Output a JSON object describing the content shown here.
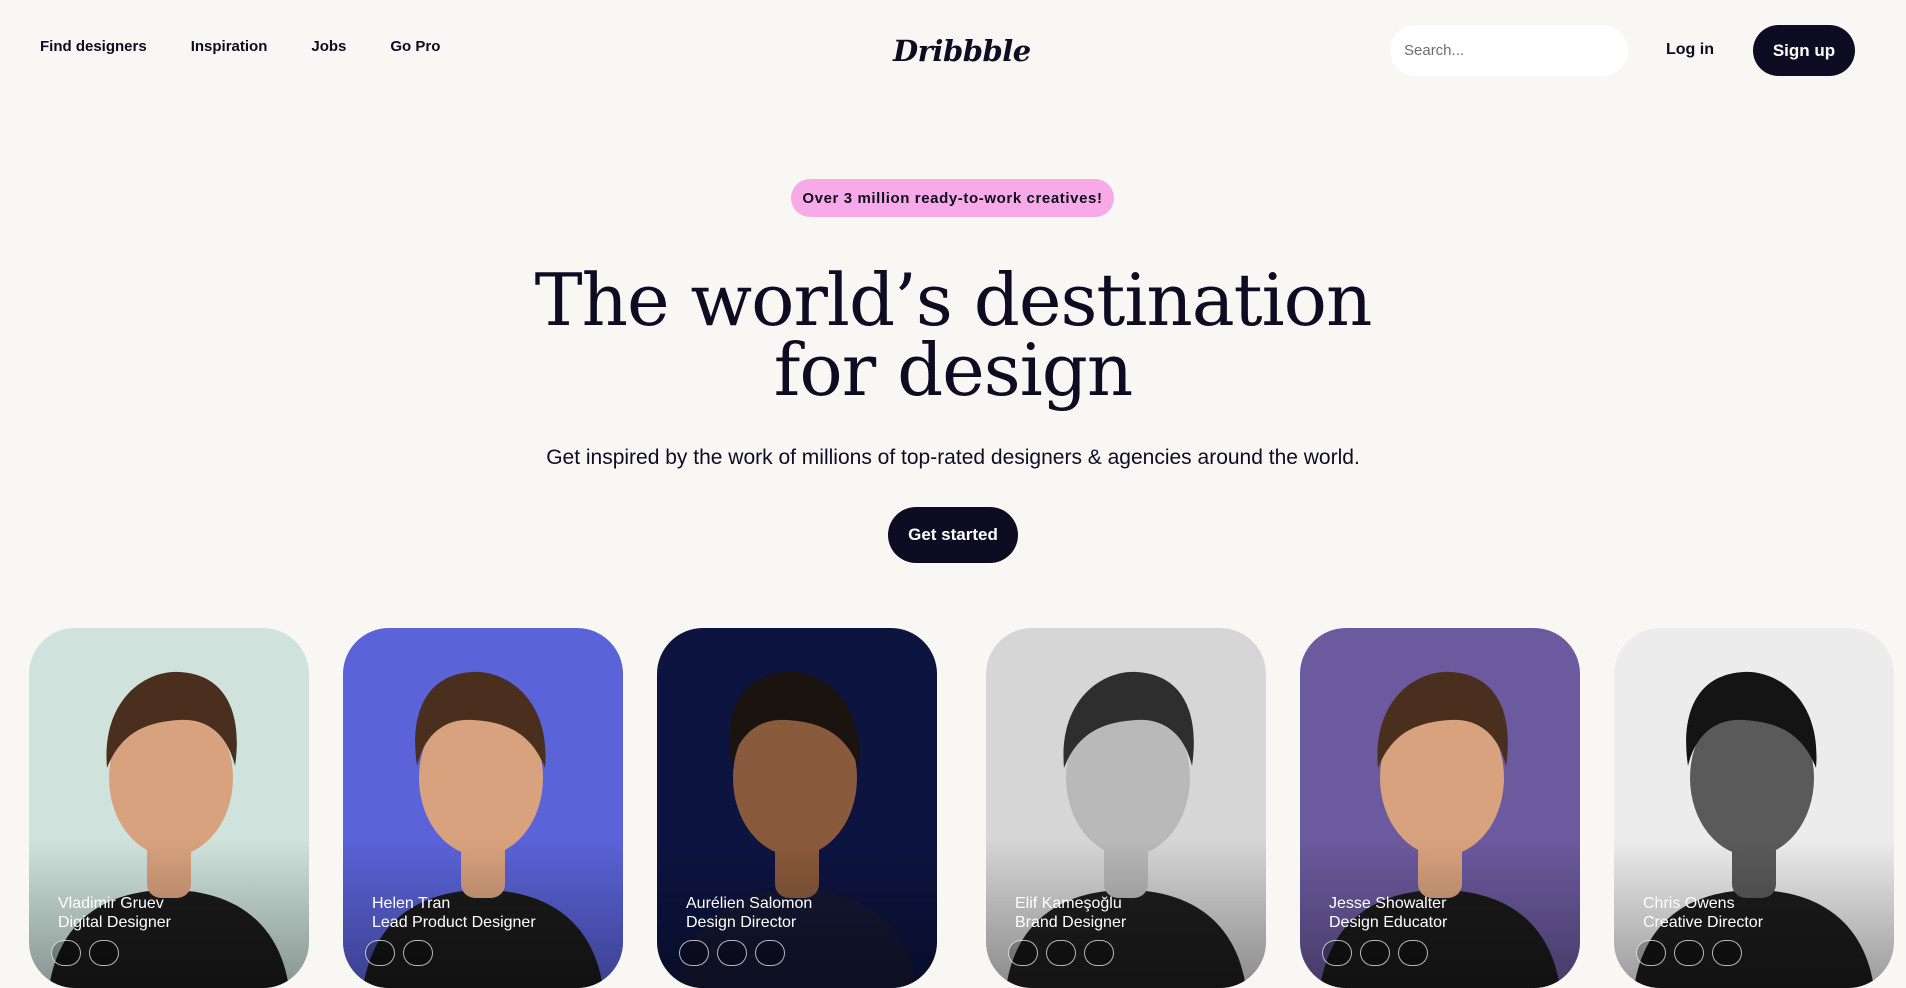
{
  "nav": {
    "links": [
      {
        "label": "Find designers"
      },
      {
        "label": "Inspiration"
      },
      {
        "label": "Jobs"
      },
      {
        "label": "Go Pro"
      }
    ],
    "logo": "Dribbble",
    "search_placeholder": "Search...",
    "login_label": "Log in",
    "signup_label": "Sign up"
  },
  "hero": {
    "badge": "Over 3 million ready-to-work creatives!",
    "headline_line1": "The world’s destination",
    "headline_line2": "for design",
    "subheadline": "Get inspired by the work of millions of top-rated designers & agencies around the world.",
    "cta_label": "Get started"
  },
  "colors": {
    "background": "#f8f7f4",
    "text": "#0d0c22",
    "badge": "#f8a9e8",
    "button": "#0d0c22"
  },
  "designers": [
    {
      "name": "Vladimir Gruev",
      "role": "Digital Designer",
      "bg": "#cfe3dc",
      "style": "warm",
      "flip": false
    },
    {
      "name": "Helen Tran",
      "role": "Lead Product Designer",
      "bg": "#5a63d8",
      "style": "warm",
      "flip": true
    },
    {
      "name": "Aurélien Salomon",
      "role": "Design Director",
      "bg": "#0d1440",
      "style": "dark",
      "flip": true
    },
    {
      "name": "Elif Kameşoğlu",
      "role": "Brand Designer",
      "bg": "#d6d6d6",
      "style": "mono",
      "flip": false
    },
    {
      "name": "Jesse Showalter",
      "role": "Design Educator",
      "bg": "#6b5a9e",
      "style": "warm",
      "flip": false
    },
    {
      "name": "Chris Owens",
      "role": "Creative Director",
      "bg": "#ececec",
      "style": "monodark",
      "flip": true
    }
  ]
}
